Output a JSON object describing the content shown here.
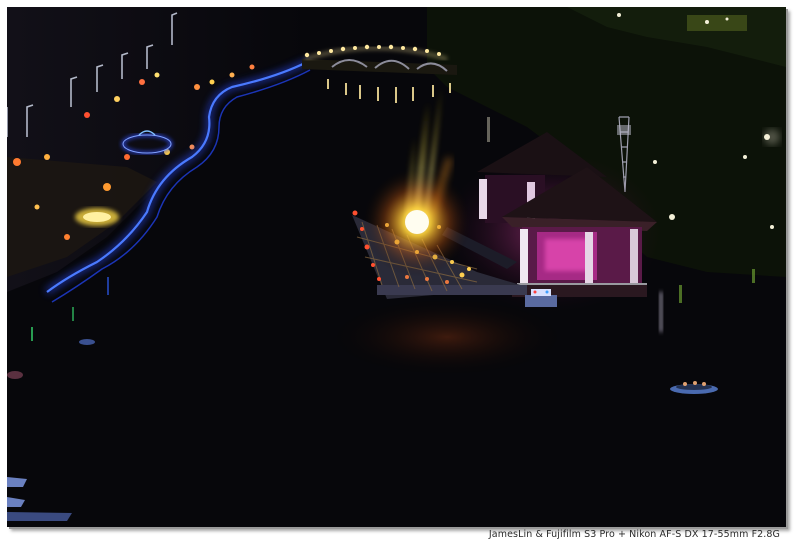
{
  "photo": {
    "alt": "Night photograph of a lakeside lantern festival with a fountain show",
    "caption": "JamesLin & Fujifilm S3 Pro + Nikon AF-S DX 17-55mm F2.8G"
  },
  "colors": {
    "frame": "#ffffff",
    "water": "#07070b",
    "neon_blue": "#2a4bff",
    "fountain_yellow": "#ffd23a",
    "pavilion_magenta": "#c0309a",
    "lamp_white": "#f4f0d8"
  }
}
